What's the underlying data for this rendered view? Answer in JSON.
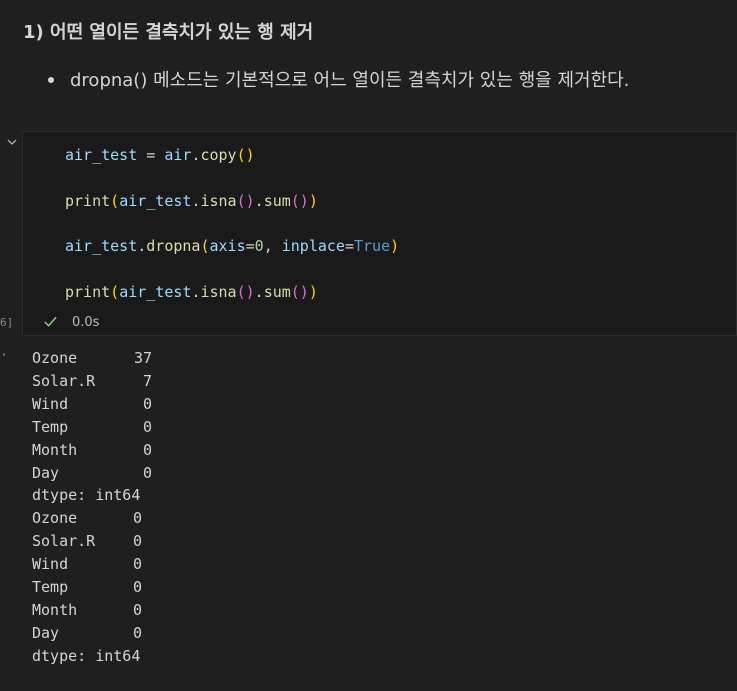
{
  "markdown": {
    "heading": "1) 어떤 열이든 결측치가 있는 행 제거",
    "bullet": "dropna() 메소드는 기본적으로 어느 열이든 결측치가 있는 행을 제거한다."
  },
  "cell": {
    "execution_count": "6]",
    "status_time": "0.0s",
    "icons": {
      "collapse": "chevron-down-icon",
      "status": "check-icon"
    },
    "colors": {
      "success": "#89d185",
      "variable": "#9cdcfe",
      "function": "#dcdcaa",
      "bracket1": "#ffd700",
      "bracket2": "#da70d6",
      "bracket3": "#179fff",
      "keyword": "#569cd6",
      "number": "#b5cea8"
    },
    "code": [
      "air_test = air.copy()",
      "print(air_test.isna().sum())",
      "air_test.dropna(axis=0, inplace=True)",
      "print(air_test.isna().sum())"
    ]
  },
  "output": {
    "marker": "·",
    "blocks": [
      {
        "rows": [
          {
            "name": "Ozone",
            "value": "37"
          },
          {
            "name": "Solar.R",
            "value": "7"
          },
          {
            "name": "Wind",
            "value": "0"
          },
          {
            "name": "Temp",
            "value": "0"
          },
          {
            "name": "Month",
            "value": "0"
          },
          {
            "name": "Day",
            "value": "0"
          }
        ],
        "dtype": "dtype: int64"
      },
      {
        "rows": [
          {
            "name": "Ozone",
            "value": "0"
          },
          {
            "name": "Solar.R",
            "value": "0"
          },
          {
            "name": "Wind",
            "value": "0"
          },
          {
            "name": "Temp",
            "value": "0"
          },
          {
            "name": "Month",
            "value": "0"
          },
          {
            "name": "Day",
            "value": "0"
          }
        ],
        "dtype": "dtype: int64"
      }
    ]
  }
}
